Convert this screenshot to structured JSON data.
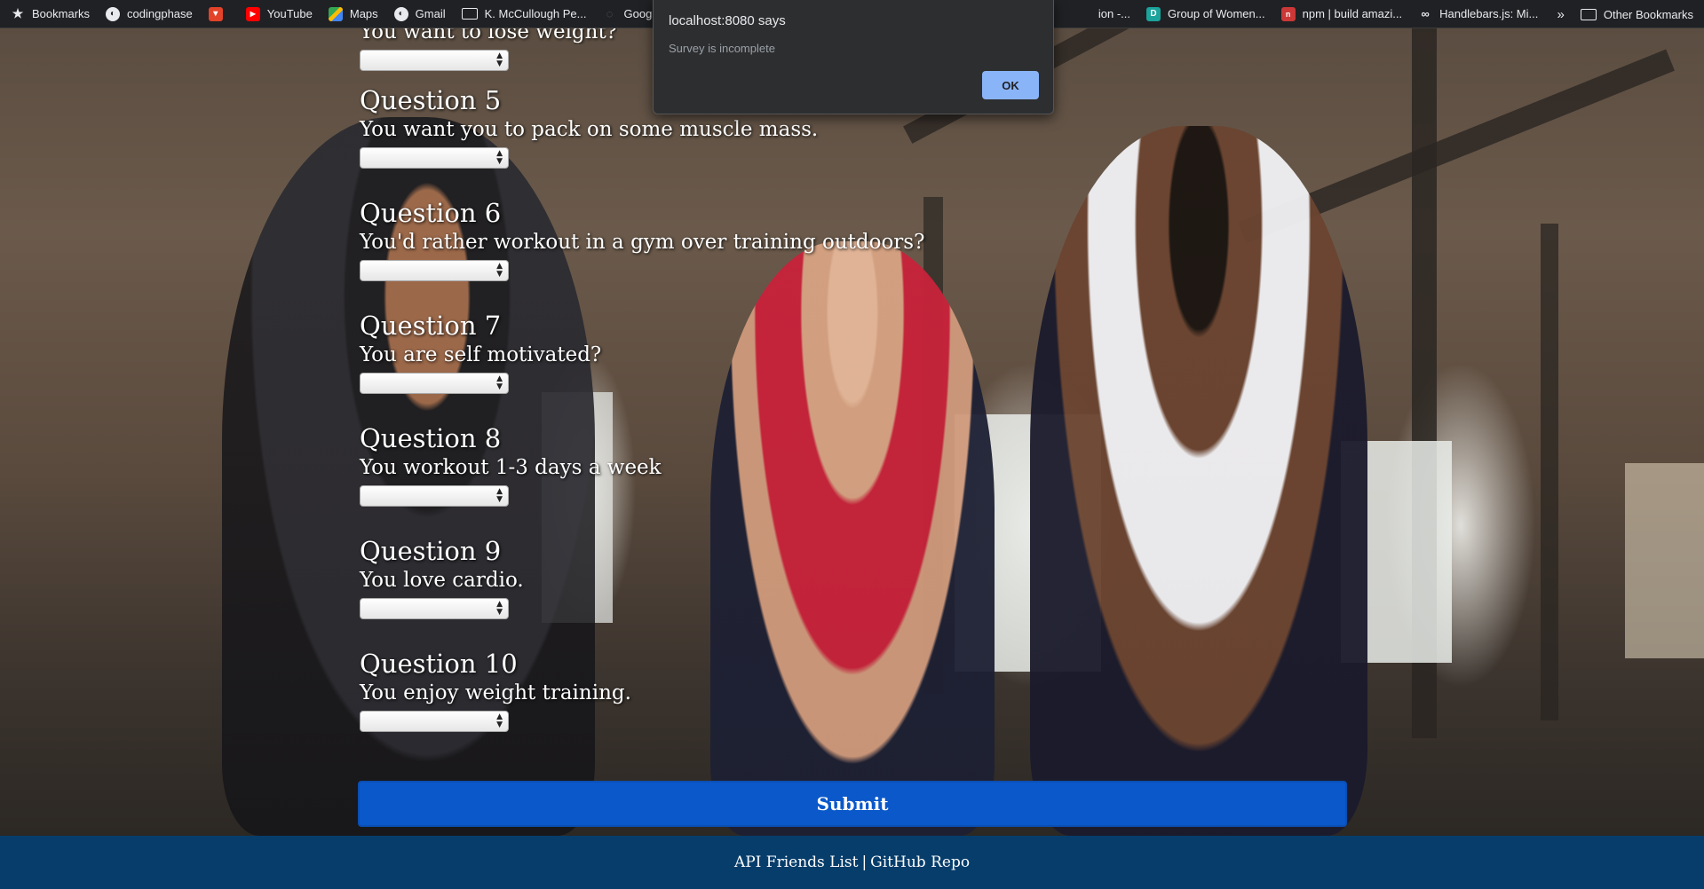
{
  "bookmarks_bar": {
    "items": [
      {
        "label": "Bookmarks",
        "icon": "star-icon"
      },
      {
        "label": "codingphase",
        "icon": "globe-icon"
      },
      {
        "label": "",
        "icon": "gitlab-icon"
      },
      {
        "label": "YouTube",
        "icon": "youtube-icon"
      },
      {
        "label": "Maps",
        "icon": "maps-icon"
      },
      {
        "label": "Gmail",
        "icon": "globe-icon"
      },
      {
        "label": "K. McCullough Pe...",
        "icon": "folder-icon"
      },
      {
        "label": "Google Cod",
        "icon": "code-icon"
      },
      {
        "label": "ion -...",
        "icon": ""
      },
      {
        "label": "Group of Women...",
        "icon": "d-icon"
      },
      {
        "label": "npm | build amazi...",
        "icon": "npm-icon"
      },
      {
        "label": "Handlebars.js: Mi...",
        "icon": "link-icon"
      }
    ],
    "overflow": "»",
    "other_bookmarks": "Other Bookmarks"
  },
  "survey": {
    "partial_question_text": "You want to lose weight?",
    "questions": [
      {
        "title": "Question 5",
        "text": "You want you to pack on some muscle mass.",
        "value": ""
      },
      {
        "title": "Question 6",
        "text": "You'd rather workout in a gym over training outdoors?",
        "value": ""
      },
      {
        "title": "Question 7",
        "text": "You are self motivated?",
        "value": ""
      },
      {
        "title": "Question 8",
        "text": "You workout 1-3 days a week",
        "value": ""
      },
      {
        "title": "Question 9",
        "text": "You love cardio.",
        "value": ""
      },
      {
        "title": "Question 10",
        "text": "You enjoy weight training.",
        "value": ""
      }
    ],
    "submit_label": "Submit"
  },
  "footer": {
    "api_link": "API Friends List",
    "separator": "|",
    "github_link": "GitHub Repo"
  },
  "dialog": {
    "title": "localhost:8080 says",
    "message": "Survey is incomplete",
    "ok_label": "OK"
  },
  "colors": {
    "submit_bg": "#0a58ca",
    "footer_bg": "#063d6b",
    "dialog_bg": "#2d2e30",
    "dialog_ok_bg": "#8ab4f8"
  }
}
